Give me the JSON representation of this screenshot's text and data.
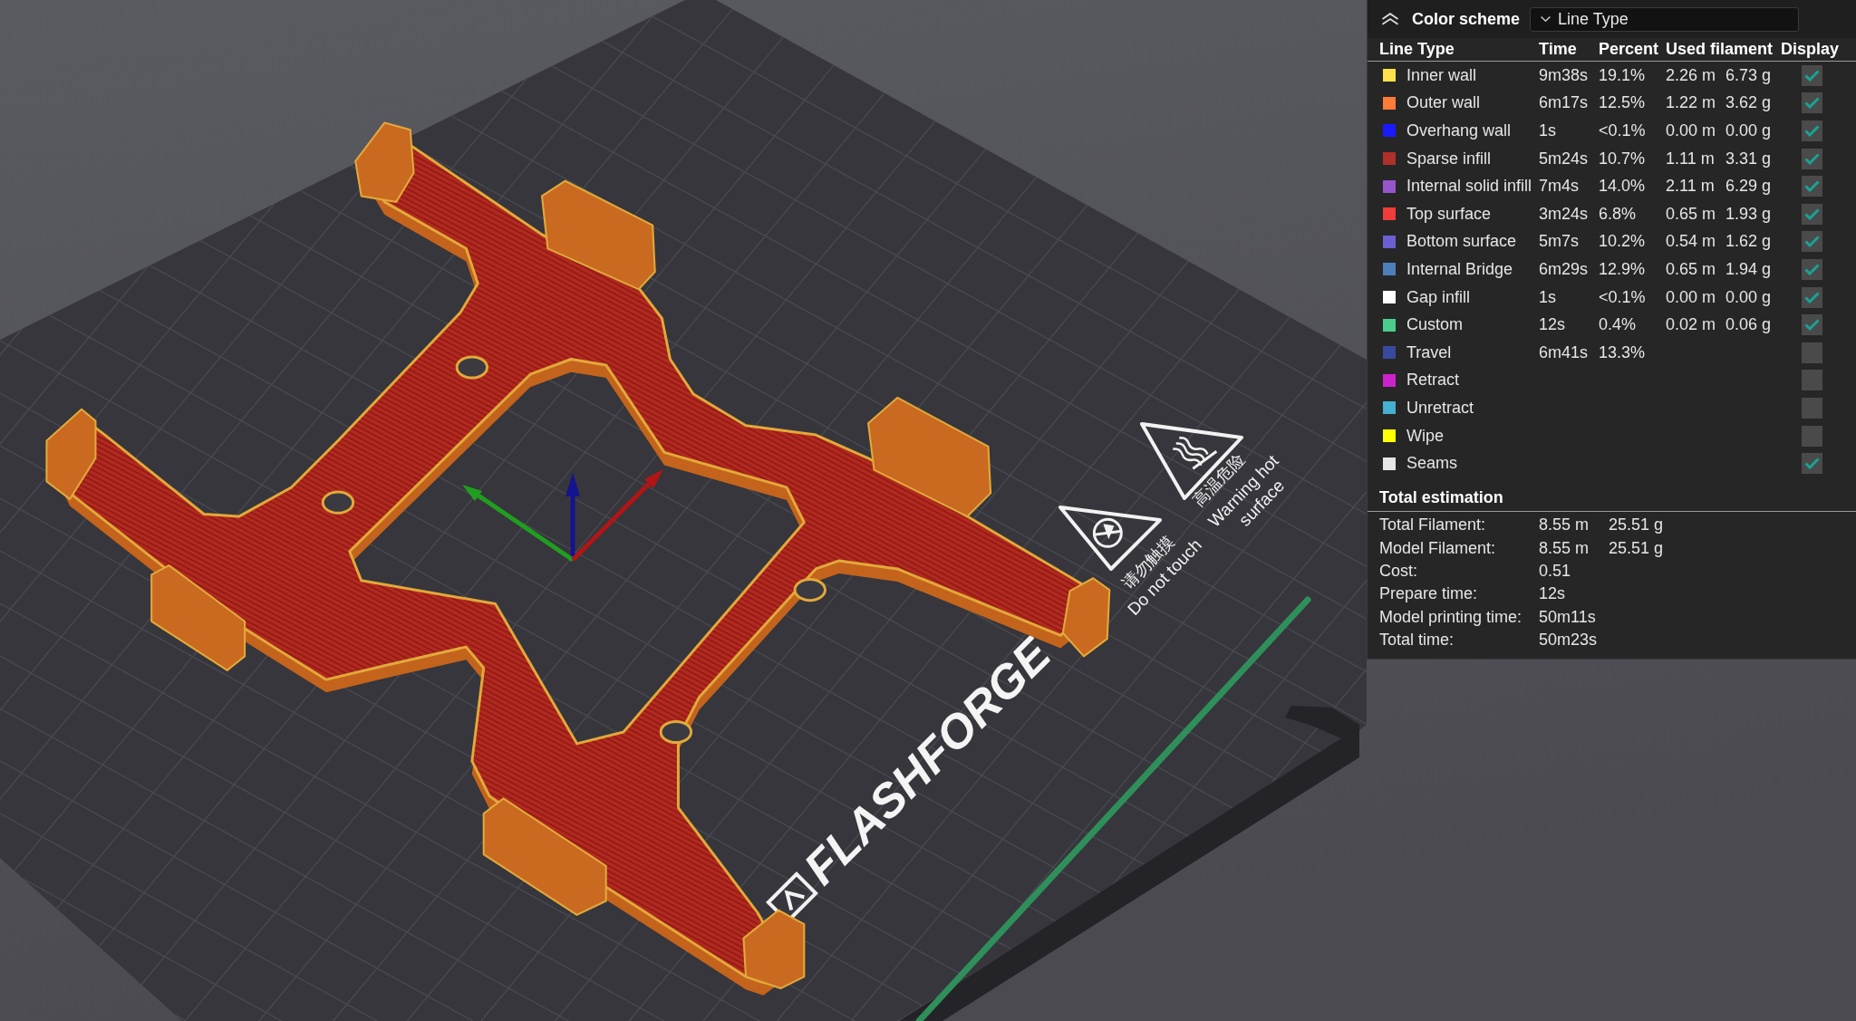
{
  "viewport": {
    "bed_signs": [
      {
        "kind": "no_touch",
        "label_zh": "请勿触摸",
        "label_en_lines": [
          "Do not touch"
        ]
      },
      {
        "kind": "hot_surface",
        "label_zh": "高温危险",
        "label_en_lines": [
          "Warning hot",
          "surface"
        ]
      }
    ],
    "bed_logo": "FLASHFORGE"
  },
  "legend": {
    "title": "Color scheme",
    "scheme_dropdown": {
      "value": "Line Type"
    },
    "columns": [
      "Line Type",
      "Time",
      "Percent",
      "Used filament",
      "Display"
    ],
    "rows": [
      {
        "name": "Inner wall",
        "color": "#ffe14d",
        "time": "9m38s",
        "percent": "19.1%",
        "length": "2.26 m",
        "weight": "6.73 g",
        "checked": true
      },
      {
        "name": "Outer wall",
        "color": "#ff7b38",
        "time": "6m17s",
        "percent": "12.5%",
        "length": "1.22 m",
        "weight": "3.62 g",
        "checked": true
      },
      {
        "name": "Overhang wall",
        "color": "#1a1aff",
        "time": "1s",
        "percent": "<0.1%",
        "length": "0.00 m",
        "weight": "0.00 g",
        "checked": true
      },
      {
        "name": "Sparse infill",
        "color": "#b0302a",
        "time": "5m24s",
        "percent": "10.7%",
        "length": "1.11 m",
        "weight": "3.31 g",
        "checked": true
      },
      {
        "name": "Internal solid infill",
        "color": "#9655cc",
        "time": "7m4s",
        "percent": "14.0%",
        "length": "2.11 m",
        "weight": "6.29 g",
        "checked": true
      },
      {
        "name": "Top surface",
        "color": "#f03c3c",
        "time": "3m24s",
        "percent": "6.8%",
        "length": "0.65 m",
        "weight": "1.93 g",
        "checked": true
      },
      {
        "name": "Bottom surface",
        "color": "#6b5fd0",
        "time": "5m7s",
        "percent": "10.2%",
        "length": "0.54 m",
        "weight": "1.62 g",
        "checked": true
      },
      {
        "name": "Internal Bridge",
        "color": "#4d80ba",
        "time": "6m29s",
        "percent": "12.9%",
        "length": "0.65 m",
        "weight": "1.94 g",
        "checked": true
      },
      {
        "name": "Gap infill",
        "color": "#ffffff",
        "time": "1s",
        "percent": "<0.1%",
        "length": "0.00 m",
        "weight": "0.00 g",
        "checked": true
      },
      {
        "name": "Custom",
        "color": "#4ccc8c",
        "time": "12s",
        "percent": "0.4%",
        "length": "0.02 m",
        "weight": "0.06 g",
        "checked": true
      },
      {
        "name": "Travel",
        "color": "#374a9e",
        "time": "6m41s",
        "percent": "13.3%",
        "checked": false
      },
      {
        "name": "Retract",
        "color": "#cc22cc",
        "checked": false
      },
      {
        "name": "Unretract",
        "color": "#45b0cf",
        "checked": false
      },
      {
        "name": "Wipe",
        "color": "#ffff00",
        "checked": false
      },
      {
        "name": "Seams",
        "color": "#e6e6e6",
        "checked": true
      }
    ]
  },
  "total_estimation": {
    "title": "Total estimation",
    "rows": [
      {
        "label": "Total Filament:",
        "values": [
          "8.55 m",
          "25.51 g"
        ]
      },
      {
        "label": "Model Filament:",
        "values": [
          "8.55 m",
          "25.51 g"
        ]
      },
      {
        "label": "Cost:",
        "values": [
          "0.51"
        ]
      },
      {
        "label": "Prepare time:",
        "values": [
          "12s"
        ]
      },
      {
        "label": "Model printing time:",
        "values": [
          "50m11s"
        ]
      },
      {
        "label": "Total time:",
        "values": [
          "50m23s"
        ]
      }
    ]
  }
}
